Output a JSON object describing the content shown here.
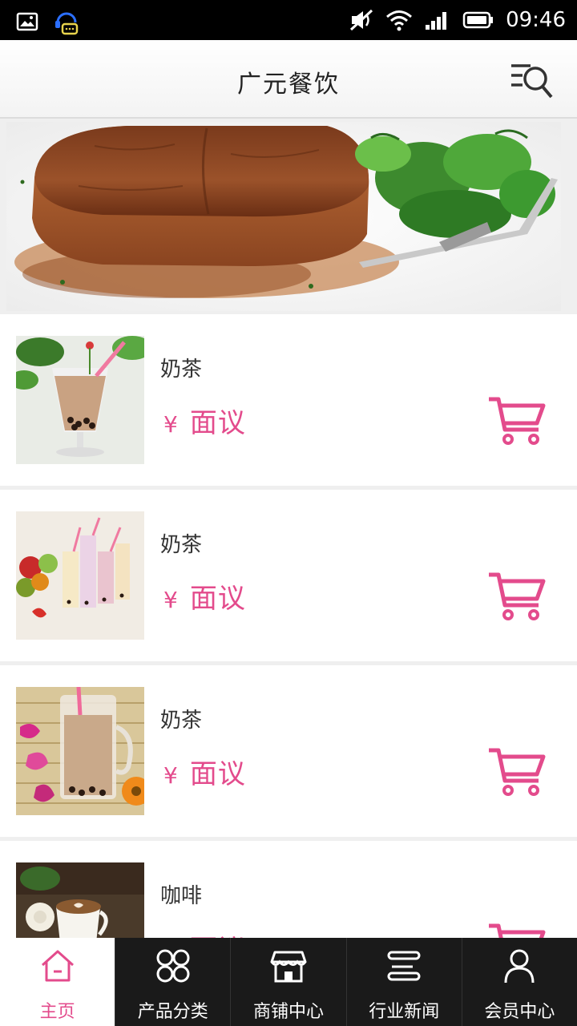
{
  "status_bar": {
    "time": "09:46",
    "icons": [
      "image-icon",
      "chat-headset-icon",
      "mute-icon",
      "wifi-icon",
      "signal-icon",
      "battery-icon"
    ]
  },
  "header": {
    "title": "广元餐饮",
    "search_icon": "search-menu-icon"
  },
  "banner": {
    "image": "steak-with-salad-photo"
  },
  "products": [
    {
      "name": "奶茶",
      "currency": "¥",
      "price": "面议",
      "image": "bubble-tea-glass-photo"
    },
    {
      "name": "奶茶",
      "currency": "¥",
      "price": "面议",
      "image": "fruit-milk-teas-photo"
    },
    {
      "name": "奶茶",
      "currency": "¥",
      "price": "面议",
      "image": "milk-tea-mug-flowers-photo"
    },
    {
      "name": "咖啡",
      "currency": "¥",
      "price": "面议",
      "image": "coffee-cup-photo"
    }
  ],
  "bottom_nav": [
    {
      "label": "主页",
      "icon": "home-icon",
      "active": true
    },
    {
      "label": "产品分类",
      "icon": "category-icon",
      "active": false
    },
    {
      "label": "商铺中心",
      "icon": "store-icon",
      "active": false
    },
    {
      "label": "行业新闻",
      "icon": "news-icon",
      "active": false
    },
    {
      "label": "会员中心",
      "icon": "user-icon",
      "active": false
    }
  ],
  "colors": {
    "accent": "#e34b8c",
    "status_bar": "#000000",
    "nav_background": "#1a1a1a"
  }
}
